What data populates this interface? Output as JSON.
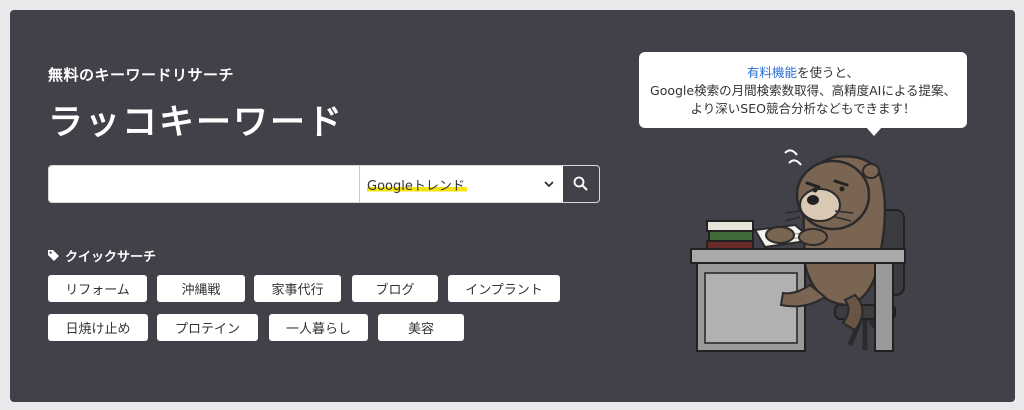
{
  "hero": {
    "subtitle": "無料のキーワードリサーチ",
    "title": "ラッコキーワード"
  },
  "search": {
    "input_value": "",
    "select_value": "Googleトレンド",
    "button_icon": "search-icon"
  },
  "quick_search": {
    "label": "クイックサーチ",
    "icon": "tag-icon",
    "chips": [
      "リフォーム",
      "沖縄戦",
      "家事代行",
      "ブログ",
      "インプラント",
      "日焼け止め",
      "プロテイン",
      "一人暮らし",
      "美容"
    ]
  },
  "bubble": {
    "link": "有料機能",
    "line1_rest": "を使うと、",
    "line2": "Google検索の月間検索数取得、高精度AIによる提案、",
    "line3": "より深いSEO競合分析などもできます！"
  },
  "colors": {
    "hero_bg": "#424149",
    "highlight": "#f5e30f",
    "link": "#2a6fd6"
  }
}
